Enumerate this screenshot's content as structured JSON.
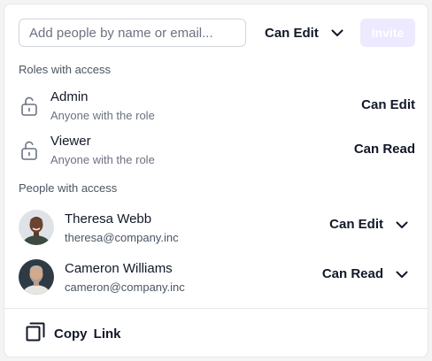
{
  "search": {
    "placeholder": "Add people by name or email..."
  },
  "invite_permission": {
    "selected": "Can Edit",
    "icon": "chevron-down-icon"
  },
  "invite_button": {
    "label": "Invite"
  },
  "roles_section": {
    "title": "Roles with access",
    "items": [
      {
        "name": "Admin",
        "subtitle": "Anyone with the role",
        "permission": "Can Edit",
        "icon": "unlock-icon"
      },
      {
        "name": "Viewer",
        "subtitle": "Anyone with the role",
        "permission": "Can Read",
        "icon": "unlock-icon"
      }
    ]
  },
  "people_section": {
    "title": "People with access",
    "items": [
      {
        "name": "Theresa Webb",
        "email": "theresa@company.inc",
        "permission": "Can Edit"
      },
      {
        "name": "Cameron Williams",
        "email": "cameron@company.inc",
        "permission": "Can Read"
      }
    ]
  },
  "copy_link": {
    "label": "Copy  Link",
    "icon": "copy-icon"
  },
  "colors": {
    "accent_disabled": "#ede9fe",
    "border": "#e5e7eb",
    "text_muted": "#6b7280"
  }
}
